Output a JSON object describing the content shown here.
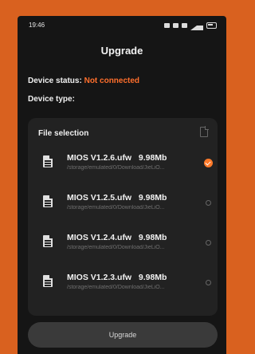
{
  "status_bar": {
    "time": "19:46"
  },
  "header": {
    "title": "Upgrade"
  },
  "device": {
    "status_label": "Device status:",
    "status_value": "Not connected",
    "type_label": "Device type:"
  },
  "file_selection": {
    "title": "File selection",
    "items": [
      {
        "name": "MIOS V1.2.6.ufw",
        "size": "9.98Mb",
        "path": "/storage/emulated/0/Download/JieLiO...",
        "selected": true
      },
      {
        "name": "MIOS V1.2.5.ufw",
        "size": "9.98Mb",
        "path": "/storage/emulated/0/Download/JieLiO...",
        "selected": false
      },
      {
        "name": "MIOS V1.2.4.ufw",
        "size": "9.98Mb",
        "path": "/storage/emulated/0/Download/JieLiO...",
        "selected": false
      },
      {
        "name": "MIOS V1.2.3.ufw",
        "size": "9.98Mb",
        "path": "/storage/emulated/0/Download/JieLiO...",
        "selected": false
      }
    ]
  },
  "actions": {
    "upgrade_label": "Upgrade"
  },
  "colors": {
    "accent": "#ff7a2a",
    "background": "#151515",
    "card": "#222222",
    "frame": "#d9611f"
  }
}
